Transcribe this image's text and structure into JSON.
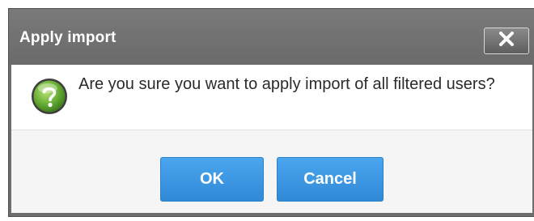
{
  "dialog": {
    "title": "Apply import",
    "close_icon": "close-icon",
    "question_icon": "question-icon",
    "message": "Are you sure you want to apply import of all filtered users?",
    "ok_label": "OK",
    "cancel_label": "Cancel"
  },
  "colors": {
    "titlebar": "#6d6d6d",
    "button_blue": "#3d97e3",
    "icon_green": "#6fb43a"
  }
}
